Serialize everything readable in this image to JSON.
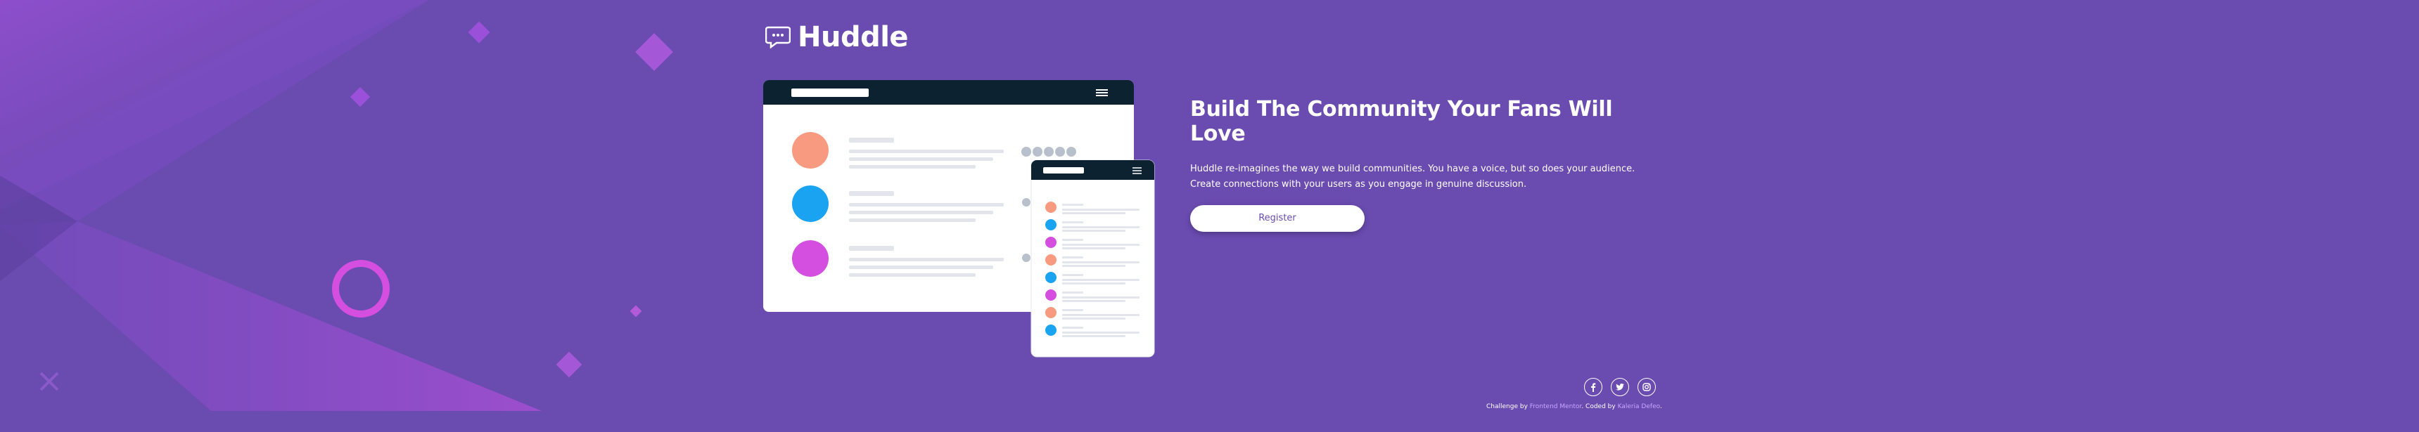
{
  "brand": {
    "name": "Huddle"
  },
  "hero": {
    "title": "Build The Community Your Fans Will Love",
    "description": "Huddle re-imagines the way we build communities. You have a voice, but so does your audience. Create connections with your users as you engage in genuine discussion.",
    "register_label": "Register"
  },
  "footer": {
    "socials": [
      "facebook-icon",
      "twitter-icon",
      "instagram-icon"
    ],
    "challenge_by": "Challenge by",
    "challenge_link": "Frontend Mentor",
    "separator": ".",
    "coded_by": "Coded by",
    "coder_link": "Kaleria Defeo",
    "end": "."
  },
  "colors": {
    "background": "#6a4bb0",
    "accent_pink": "#d44ee0",
    "dark_navy": "#0c2230",
    "white": "#ffffff"
  }
}
